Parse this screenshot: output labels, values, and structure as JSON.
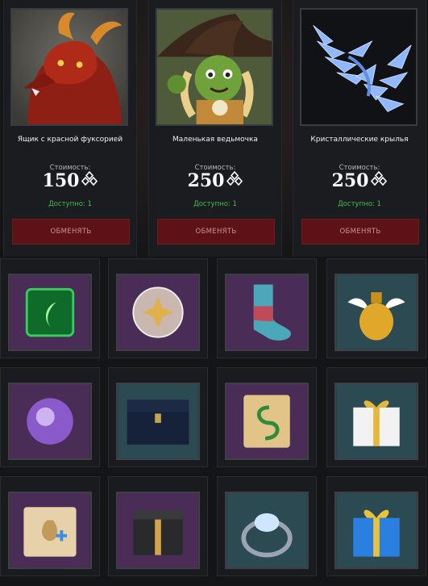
{
  "offers": [
    {
      "name": "Ящик с красной фуксорией",
      "cost_label": "Стоимость:",
      "price": "150",
      "available": "Доступно: 1",
      "button": "ОБМЕНЯТЬ",
      "art": "red-fox-creature"
    },
    {
      "name": "Маленькая ведьмочка",
      "cost_label": "Стоимость:",
      "price": "250",
      "available": "Доступно: 1",
      "button": "ОБМЕНЯТЬ",
      "art": "little-witch"
    },
    {
      "name": "Кристаллические крылья",
      "cost_label": "Стоимость:",
      "price": "250",
      "available": "Доступно: 1",
      "button": "ОБМЕНЯТЬ",
      "art": "crystal-wings"
    }
  ],
  "currency_icon": "triple-diamond-icon",
  "colors": {
    "button_bg": "#5c1216",
    "available_text": "#3fbf52",
    "purple_tile": "#4a2d57",
    "teal_tile": "#2c4a52"
  },
  "items": [
    {
      "art": "green-gem",
      "bg": "purple"
    },
    {
      "art": "glowing-orb",
      "bg": "purple"
    },
    {
      "art": "sock",
      "bg": "purple"
    },
    {
      "art": "golden-potion",
      "bg": "teal"
    },
    {
      "art": "purple-orb",
      "bg": "purple"
    },
    {
      "art": "dark-chest",
      "bg": "teal"
    },
    {
      "art": "scroll-green-rune",
      "bg": "purple"
    },
    {
      "art": "white-gift-box",
      "bg": "teal"
    },
    {
      "art": "treasure-map",
      "bg": "purple"
    },
    {
      "art": "black-gift-box",
      "bg": "purple"
    },
    {
      "art": "crystal-ring",
      "bg": "teal"
    },
    {
      "art": "blue-gift-box",
      "bg": "teal"
    }
  ]
}
